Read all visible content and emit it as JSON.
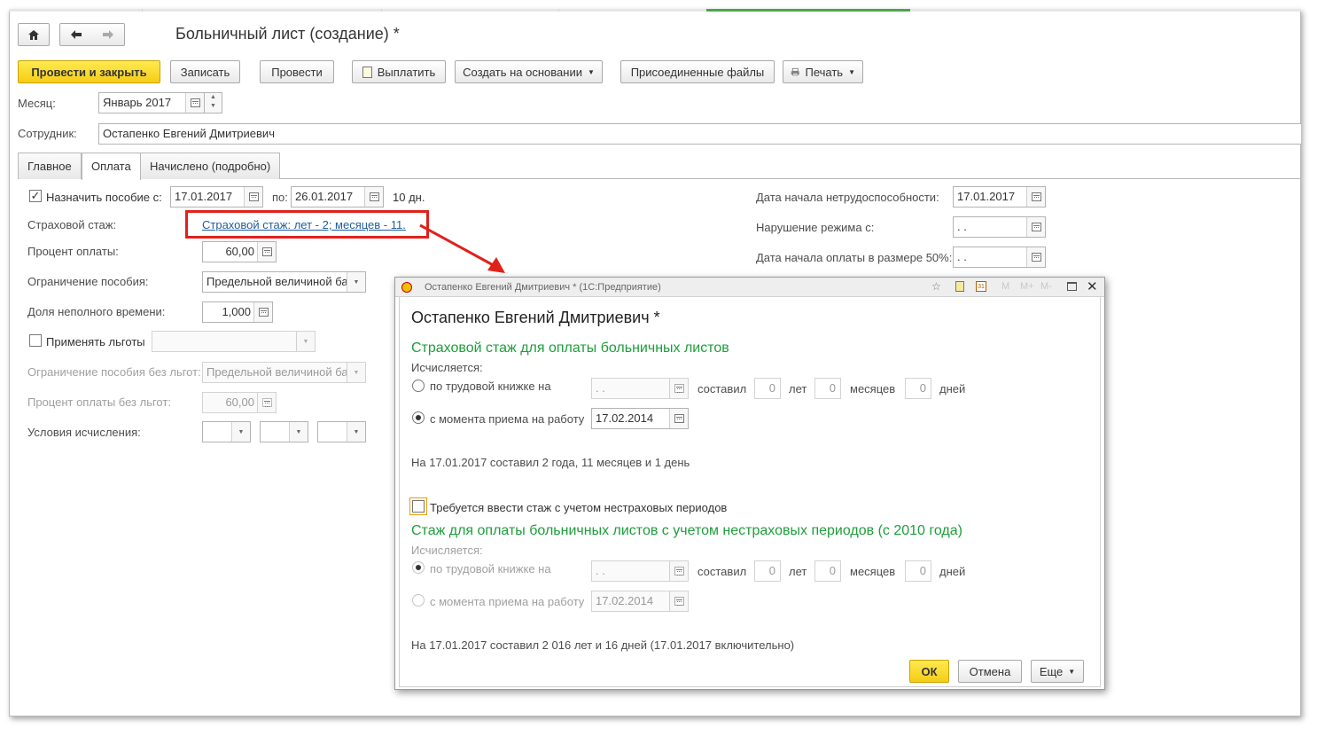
{
  "window": {
    "title": "Больничный лист (создание) *"
  },
  "toolbar": {
    "post_close": "Провести и закрыть",
    "save": "Записать",
    "post": "Провести",
    "pay": "Выплатить",
    "create_based": "Создать на основании",
    "attached_files": "Присоединенные файлы",
    "print": "Печать"
  },
  "header": {
    "month_label": "Месяц:",
    "month_value": "Январь 2017",
    "employee_label": "Сотрудник:",
    "employee_value": "Остапенко Евгений Дмитриевич"
  },
  "tabs": [
    {
      "label": "Главное"
    },
    {
      "label": "Оплата"
    },
    {
      "label": "Начислено (подробно)"
    }
  ],
  "payment": {
    "assign_label": "Назначить пособие с:",
    "assign_from": "17.01.2017",
    "to_label": "по:",
    "assign_to": "26.01.2017",
    "days": "10 дн.",
    "insurance_label": "Страховой стаж:",
    "insurance_link": "Страховой стаж: лет - 2; месяцев - 11.",
    "percent_label": "Процент оплаты:",
    "percent_value": "60,00",
    "limit_label": "Ограничение пособия:",
    "limit_value": "Предельной величиной ба",
    "part_time_label": "Доля неполного времени:",
    "part_time_value": "1,000",
    "benefits_label": "Применять льготы",
    "limit_no_benefits_label": "Ограничение пособия без льгот:",
    "limit_no_benefits_value": "Предельной величиной ба",
    "percent_no_benefits_label": "Процент оплаты без льгот:",
    "percent_no_benefits_value": "60,00",
    "conditions_label": "Условия исчисления:",
    "disability_start_label": "Дата начала нетрудоспособности:",
    "disability_start_value": "17.01.2017",
    "violation_label": "Нарушение режима с:",
    "violation_value": " .  .",
    "half_pay_label": "Дата начала оплаты в размере 50%:",
    "half_pay_value": " .  ."
  },
  "dialog": {
    "window_title": "Остапенко Евгений Дмитриевич * (1С:Предприятие)",
    "heading": "Остапенко Евгений Дмитриевич *",
    "section1_title": "Страховой стаж для оплаты больничных листов",
    "calc_label": "Исчисляется:",
    "option_workbook": "по трудовой книжке на",
    "workbook_date": " .  .",
    "composed_label": "составил",
    "years_value": "0",
    "years_label": "лет",
    "months_value": "0",
    "months_label": "месяцев",
    "days_value": "0",
    "days_label": "дней",
    "option_hire": "с момента приема на работу",
    "hire_date": "17.02.2014",
    "summary1": "На 17.01.2017 составил 2 года, 11 месяцев и 1 день",
    "noninsurance_checkbox": "Требуется ввести стаж с учетом нестраховых периодов",
    "section2_title": "Стаж для оплаты больничных листов с учетом нестраховых периодов (с 2010 года)",
    "calc_label2": "Исчисляется:",
    "option_workbook2": "по трудовой книжке на",
    "workbook_date2": " .  .",
    "composed_label2": "составил",
    "years_value2": "0",
    "years_label2": "лет",
    "months_value2": "0",
    "months_label2": "месяцев",
    "days_value2": "0",
    "days_label2": "дней",
    "option_hire2": "с момента приема на работу",
    "hire_date2": "17.02.2014",
    "summary2": "На 17.01.2017 составил 2 016 лет и 16 дней (17.01.2017 включительно)",
    "ok": "ОК",
    "cancel": "Отмена",
    "more": "Еще",
    "title_icons": [
      "M",
      "M+",
      "M-"
    ]
  },
  "colors": {
    "accent_yellow": "#f5cc16",
    "green_heading": "#1d9e3a",
    "highlight_red": "#e0201b",
    "link_blue": "#1f5e9e"
  }
}
